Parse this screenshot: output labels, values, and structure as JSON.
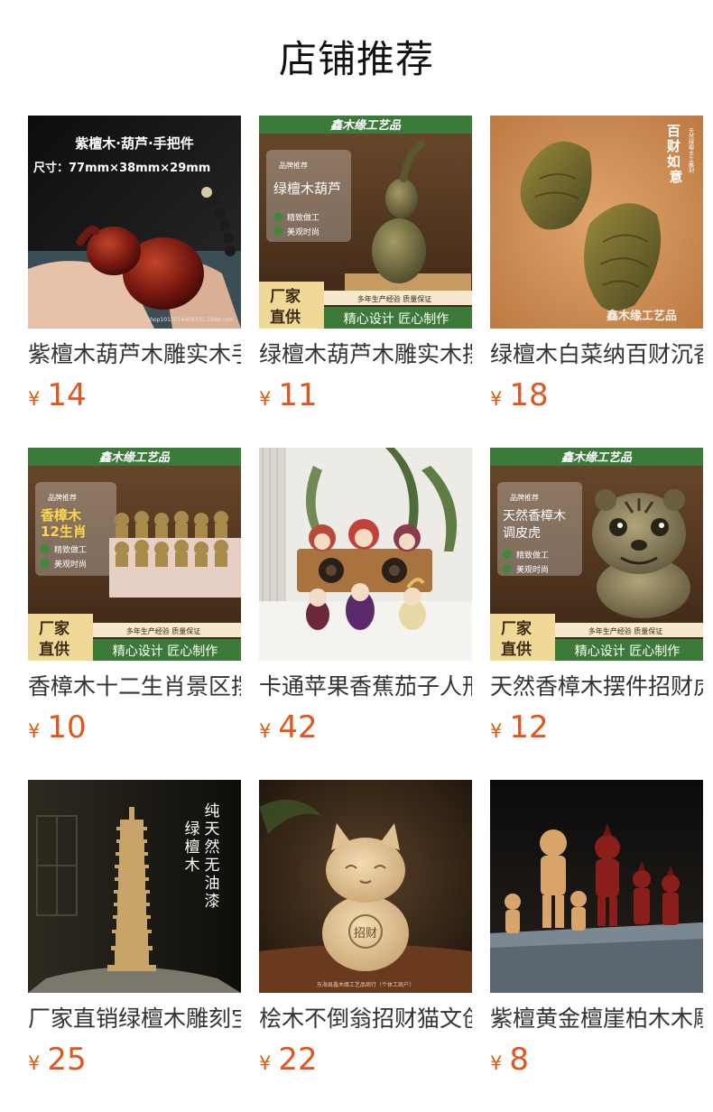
{
  "section": {
    "title": "店铺推荐"
  },
  "products": [
    {
      "name": "紫檀木葫芦木雕实木手把件",
      "currency": "¥",
      "price": "14",
      "image": {
        "icon": "gourd-photo",
        "text": [
          "紫檀木·葫芦·手把件",
          "尺寸：77mm×38mm×29mm"
        ],
        "watermark": "shop1015014458331.1688.com"
      }
    },
    {
      "name": "绿檀木葫芦木雕实木摆件",
      "currency": "¥",
      "price": "11",
      "image": {
        "icon": "gourd-photo",
        "brand": "鑫木缘工艺品",
        "badge": "品牌推荐",
        "headline": "绿檀木葫芦",
        "tags": [
          "精致做工",
          "美观时尚"
        ],
        "corner": [
          "厂家",
          "直供"
        ],
        "strip_top": "多年生产经验 质量保证",
        "strip_bottom": "精心设计 匠心制作"
      }
    },
    {
      "name": "绿檀木白菜纳百财沉香木",
      "currency": "¥",
      "price": "18",
      "image": {
        "icon": "cabbage-photo",
        "vertical": "百财如意",
        "vertical_small": "天然绿檀·手工雕刻",
        "brand": "鑫木缘工艺品"
      }
    },
    {
      "name": "香樟木十二生肖景区摆件",
      "currency": "¥",
      "price": "10",
      "image": {
        "icon": "zodiac-photo",
        "brand": "鑫木缘工艺品",
        "badge": "品牌推荐",
        "headline": "香樟木",
        "headline2": "12生肖",
        "tags": [
          "精致做工",
          "美观时尚"
        ],
        "corner": [
          "厂家",
          "直供"
        ],
        "strip_top": "多年生产经验 质量保证",
        "strip_bottom": "精心设计 匠心制作"
      }
    },
    {
      "name": "卡通苹果香蕉茄子人形摆件",
      "currency": "¥",
      "price": "42",
      "image": {
        "icon": "fruit-figures-photo"
      }
    },
    {
      "name": "天然香樟木摆件招财虎",
      "currency": "¥",
      "price": "12",
      "image": {
        "icon": "tiger-photo",
        "brand": "鑫木缘工艺品",
        "badge": "品牌推荐",
        "headline": "天然香樟木",
        "headline2": "调皮虎",
        "tags": [
          "精致做工",
          "美观时尚"
        ],
        "corner": [
          "厂家",
          "直供"
        ],
        "strip_top": "多年生产经验 质量保证",
        "strip_bottom": "精心设计 匠心制作"
      }
    },
    {
      "name": "厂家直销绿檀木雕刻宝塔",
      "currency": "¥",
      "price": "25",
      "image": {
        "icon": "pagoda-photo",
        "vertical_a": "纯天然无油漆",
        "vertical_b": "绿檀木"
      }
    },
    {
      "name": "桧木不倒翁招财猫文创",
      "currency": "¥",
      "price": "22",
      "image": {
        "icon": "lucky-cat-photo",
        "belly": "招财",
        "caption": "东海县鑫木缘工艺品商行（个体工商户）"
      }
    },
    {
      "name": "紫檀黄金檀崖柏木木雕",
      "currency": "¥",
      "price": "8",
      "image": {
        "icon": "ultraman-figures-photo"
      }
    }
  ]
}
